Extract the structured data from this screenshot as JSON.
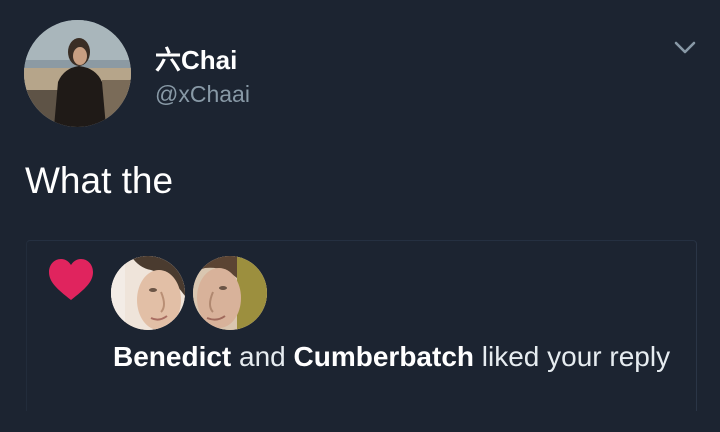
{
  "tweet": {
    "display_name": "六Chai",
    "handle": "@xChaai",
    "text": "What the"
  },
  "notification": {
    "liker_1": "Benedict",
    "joiner": "and",
    "liker_2": "Cumberbatch",
    "action": "liked your reply"
  },
  "colors": {
    "background": "#1c2431",
    "handle": "#8899a6",
    "heart": "#e0245e"
  },
  "icons": {
    "menu": "chevron-down-icon",
    "like": "heart-icon"
  }
}
